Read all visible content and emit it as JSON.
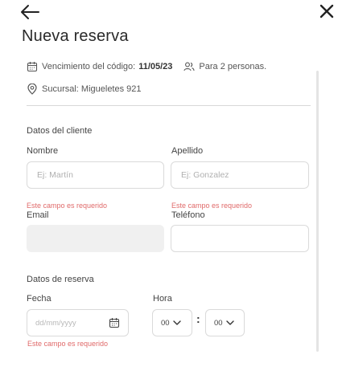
{
  "header": {
    "title": "Nueva reserva",
    "back_icon": "arrow-left-icon",
    "close_icon": "close-icon"
  },
  "info": {
    "expiry_label": "Vencimiento del código:",
    "expiry_date": "11/05/23",
    "persons": "Para 2 personas.",
    "branch": "Sucursal: Migueletes 921"
  },
  "client": {
    "section_title": "Datos del cliente",
    "nombre_label": "Nombre",
    "nombre_placeholder": "Ej: Martín",
    "nombre_error": "Este campo es requerido",
    "apellido_label": "Apellido",
    "apellido_placeholder": "Ej: Gonzalez",
    "apellido_error": "Este campo es requerido",
    "email_label": "Email",
    "email_value": "",
    "telefono_label": "Teléfono",
    "telefono_value": ""
  },
  "reservation": {
    "section_title": "Datos de reserva",
    "fecha_label": "Fecha",
    "fecha_placeholder": "dd/mm/yyyy",
    "fecha_error": "Este campo es requerido",
    "hora_label": "Hora",
    "hour_value": "00",
    "separator": ":",
    "minute_value": "00"
  },
  "colors": {
    "error": "#e06a6a",
    "border": "#dadada",
    "disabled_bg": "#f0f0f0"
  }
}
